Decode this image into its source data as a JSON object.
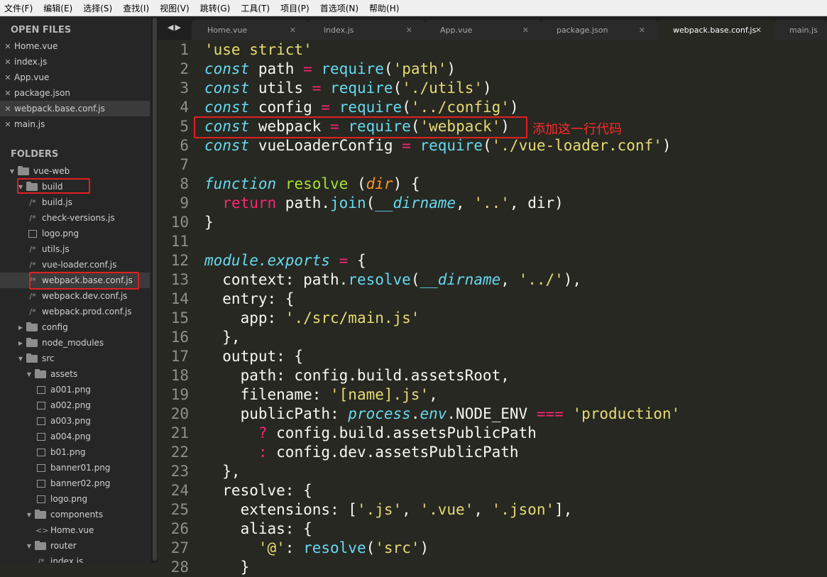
{
  "menu": [
    "文件(F)",
    "编辑(E)",
    "选择(S)",
    "查找(I)",
    "视图(V)",
    "跳转(G)",
    "工具(T)",
    "项目(P)",
    "首选项(N)",
    "帮助(H)"
  ],
  "sidebar": {
    "open_files_title": "OPEN FILES",
    "open_files": [
      "Home.vue",
      "index.js",
      "App.vue",
      "package.json",
      "webpack.base.conf.js",
      "main.js"
    ],
    "selected_open_file": "webpack.base.conf.js",
    "folders_title": "FOLDERS",
    "tree": [
      {
        "label": "vue-web",
        "type": "folder",
        "depth": 0,
        "open": true
      },
      {
        "label": "build",
        "type": "folder",
        "depth": 1,
        "open": true,
        "highlight": true
      },
      {
        "label": "build.js",
        "type": "js",
        "depth": 2
      },
      {
        "label": "check-versions.js",
        "type": "js",
        "depth": 2
      },
      {
        "label": "logo.png",
        "type": "img",
        "depth": 2
      },
      {
        "label": "utils.js",
        "type": "js",
        "depth": 2
      },
      {
        "label": "vue-loader.conf.js",
        "type": "js",
        "depth": 2
      },
      {
        "label": "webpack.base.conf.js",
        "type": "js",
        "depth": 2,
        "selected": true,
        "highlight": true
      },
      {
        "label": "webpack.dev.conf.js",
        "type": "js",
        "depth": 2
      },
      {
        "label": "webpack.prod.conf.js",
        "type": "js",
        "depth": 2
      },
      {
        "label": "config",
        "type": "folder",
        "depth": 1,
        "open": false
      },
      {
        "label": "node_modules",
        "type": "folder",
        "depth": 1,
        "open": false
      },
      {
        "label": "src",
        "type": "folder",
        "depth": 1,
        "open": true
      },
      {
        "label": "assets",
        "type": "folder",
        "depth": 2,
        "open": true
      },
      {
        "label": "a001.png",
        "type": "img",
        "depth": 3
      },
      {
        "label": "a002.png",
        "type": "img",
        "depth": 3
      },
      {
        "label": "a003.png",
        "type": "img",
        "depth": 3
      },
      {
        "label": "a004.png",
        "type": "img",
        "depth": 3
      },
      {
        "label": "b01.png",
        "type": "img",
        "depth": 3
      },
      {
        "label": "banner01.png",
        "type": "img",
        "depth": 3
      },
      {
        "label": "banner02.png",
        "type": "img",
        "depth": 3
      },
      {
        "label": "logo.png",
        "type": "img",
        "depth": 3
      },
      {
        "label": "components",
        "type": "folder",
        "depth": 2,
        "open": true
      },
      {
        "label": "Home.vue",
        "type": "vue",
        "depth": 3
      },
      {
        "label": "router",
        "type": "folder",
        "depth": 2,
        "open": true
      },
      {
        "label": "index.js",
        "type": "js",
        "depth": 3
      }
    ]
  },
  "tabs": [
    {
      "label": "Home.vue"
    },
    {
      "label": "index.js"
    },
    {
      "label": "App.vue"
    },
    {
      "label": "package.json"
    },
    {
      "label": "webpack.base.conf.js",
      "active": true
    },
    {
      "label": "main.js"
    }
  ],
  "annotation": "添加这一行代码",
  "code": [
    [
      [
        "'use strict'",
        "s"
      ]
    ],
    [
      [
        "const",
        "k"
      ],
      [
        " path ",
        "t"
      ],
      [
        "=",
        "p"
      ],
      [
        " ",
        "t"
      ],
      [
        "require",
        "f"
      ],
      [
        "(",
        "t"
      ],
      [
        "'path'",
        "s"
      ],
      [
        ")",
        "t"
      ]
    ],
    [
      [
        "const",
        "k"
      ],
      [
        " utils ",
        "t"
      ],
      [
        "=",
        "p"
      ],
      [
        " ",
        "t"
      ],
      [
        "require",
        "f"
      ],
      [
        "(",
        "t"
      ],
      [
        "'./utils'",
        "s"
      ],
      [
        ")",
        "t"
      ]
    ],
    [
      [
        "const",
        "k"
      ],
      [
        " config ",
        "t"
      ],
      [
        "=",
        "p"
      ],
      [
        " ",
        "t"
      ],
      [
        "require",
        "f"
      ],
      [
        "(",
        "t"
      ],
      [
        "'../config'",
        "s"
      ],
      [
        ")",
        "t"
      ]
    ],
    [
      [
        "const",
        "k"
      ],
      [
        " webpack ",
        "t"
      ],
      [
        "=",
        "p"
      ],
      [
        " ",
        "t"
      ],
      [
        "require",
        "f"
      ],
      [
        "(",
        "t"
      ],
      [
        "'webpack'",
        "s"
      ],
      [
        ")",
        "t"
      ]
    ],
    [
      [
        "const",
        "k"
      ],
      [
        " vueLoaderConfig ",
        "t"
      ],
      [
        "=",
        "p"
      ],
      [
        " ",
        "t"
      ],
      [
        "require",
        "f"
      ],
      [
        "(",
        "t"
      ],
      [
        "'./vue-loader.conf'",
        "s"
      ],
      [
        ")",
        "t"
      ]
    ],
    [],
    [
      [
        "function",
        "k"
      ],
      [
        " ",
        "t"
      ],
      [
        "resolve",
        "g"
      ],
      [
        " (",
        "t"
      ],
      [
        "dir",
        "o"
      ],
      [
        ") {",
        "t"
      ]
    ],
    [
      [
        "  ",
        "t"
      ],
      [
        "return",
        "p"
      ],
      [
        " path.",
        "t"
      ],
      [
        "join",
        "f"
      ],
      [
        "(",
        "t"
      ],
      [
        "__dirname",
        "v"
      ],
      [
        ", ",
        "t"
      ],
      [
        "'..'",
        "s"
      ],
      [
        ", dir)",
        "t"
      ]
    ],
    [
      [
        "}",
        "t"
      ]
    ],
    [],
    [
      [
        "module.exports",
        "v"
      ],
      [
        " ",
        "t"
      ],
      [
        "=",
        "p"
      ],
      [
        " {",
        "t"
      ]
    ],
    [
      [
        "  context: path.",
        "t"
      ],
      [
        "resolve",
        "f"
      ],
      [
        "(",
        "t"
      ],
      [
        "__dirname",
        "v"
      ],
      [
        ", ",
        "t"
      ],
      [
        "'../'",
        "s"
      ],
      [
        "),",
        "t"
      ]
    ],
    [
      [
        "  entry: {",
        "t"
      ]
    ],
    [
      [
        "    app: ",
        "t"
      ],
      [
        "'./src/main.js'",
        "s"
      ]
    ],
    [
      [
        "  },",
        "t"
      ]
    ],
    [
      [
        "  output: {",
        "t"
      ]
    ],
    [
      [
        "    path: config.build.assetsRoot,",
        "t"
      ]
    ],
    [
      [
        "    filename: ",
        "t"
      ],
      [
        "'[name].js'",
        "s"
      ],
      [
        ",",
        "t"
      ]
    ],
    [
      [
        "    publicPath: ",
        "t"
      ],
      [
        "process",
        "v"
      ],
      [
        ".",
        "t"
      ],
      [
        "env",
        "v"
      ],
      [
        ".NODE_ENV ",
        "t"
      ],
      [
        "===",
        "p"
      ],
      [
        " ",
        "t"
      ],
      [
        "'production'",
        "s"
      ]
    ],
    [
      [
        "      ",
        "t"
      ],
      [
        "?",
        "p"
      ],
      [
        " config.build.assetsPublicPath",
        "t"
      ]
    ],
    [
      [
        "      ",
        "t"
      ],
      [
        ":",
        "p"
      ],
      [
        " config.dev.assetsPublicPath",
        "t"
      ]
    ],
    [
      [
        "  },",
        "t"
      ]
    ],
    [
      [
        "  resolve: {",
        "t"
      ]
    ],
    [
      [
        "    extensions: [",
        "t"
      ],
      [
        "'.js'",
        "s"
      ],
      [
        ", ",
        "t"
      ],
      [
        "'.vue'",
        "s"
      ],
      [
        ", ",
        "t"
      ],
      [
        "'.json'",
        "s"
      ],
      [
        "],",
        "t"
      ]
    ],
    [
      [
        "    alias: {",
        "t"
      ]
    ],
    [
      [
        "      ",
        "t"
      ],
      [
        "'@'",
        "s"
      ],
      [
        ": ",
        "t"
      ],
      [
        "resolve",
        "f"
      ],
      [
        "(",
        "t"
      ],
      [
        "'src'",
        "s"
      ],
      [
        ")",
        "t"
      ]
    ],
    [
      [
        "    }",
        "t"
      ]
    ]
  ]
}
